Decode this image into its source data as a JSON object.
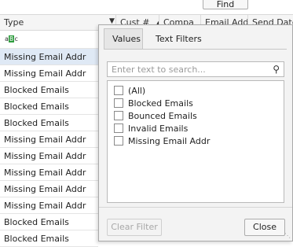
{
  "toolbar": {
    "find_label": "Find"
  },
  "header": {
    "columns": [
      "Type",
      "Cust #",
      "Compa",
      "Email Add",
      "Send Date"
    ]
  },
  "filter_row": {
    "icon_text_a": "a",
    "icon_text_b": "B",
    "icon_text_c": "c"
  },
  "rows": [
    "Missing Email Addr",
    "Missing Email Addr",
    "Blocked Emails",
    "Blocked Emails",
    "Blocked Emails",
    "Missing Email Addr",
    "Missing Email Addr",
    "Missing Email Addr",
    "Missing Email Addr",
    "Missing Email Addr",
    "Blocked Emails",
    "Blocked Emails"
  ],
  "popup": {
    "tabs": [
      "Values",
      "Text Filters"
    ],
    "search_placeholder": "Enter text to search...",
    "items": [
      "(All)",
      "Blocked Emails",
      "Bounced Emails",
      "Invalid Emails",
      "Missing Email Addr"
    ],
    "clear_filter_label": "Clear Filter",
    "close_label": "Close"
  }
}
